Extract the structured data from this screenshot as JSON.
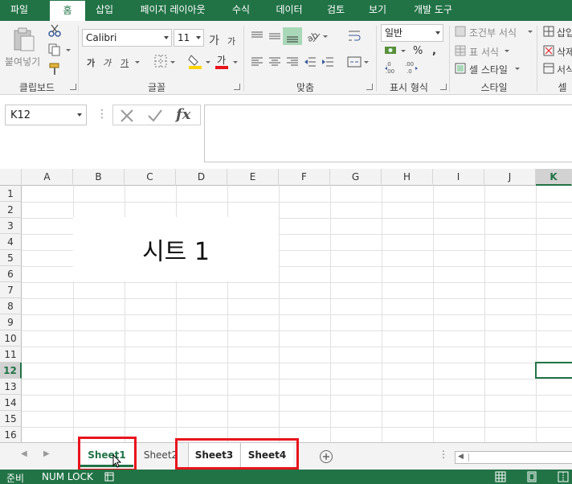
{
  "ribbon_tabs": [
    "파일",
    "홈",
    "삽입",
    "페이지 레이아웃",
    "수식",
    "데이터",
    "검토",
    "보기",
    "개발 도구"
  ],
  "active_tab": "홈",
  "clipboard": {
    "paste_label": "붙여넣기",
    "group_label": "클립보드"
  },
  "font": {
    "name": "Calibri",
    "size": "11",
    "bold": "가",
    "italic": "가",
    "underline": "가",
    "grow": "가",
    "shrink": "가",
    "font_color_char": "가",
    "group_label": "글꼴"
  },
  "alignment": {
    "group_label": "맞춤"
  },
  "number": {
    "format": "일반",
    "group_label": "표시 형식"
  },
  "styles": {
    "conditional": "조건부 서식",
    "table": "표 서식",
    "cell": "셀 스타일",
    "group_label": "스타일"
  },
  "cells": {
    "insert": "삽입",
    "delete": "삭제",
    "format": "서식",
    "group_label": "셀"
  },
  "name_box": "K12",
  "formula_value": "",
  "columns": [
    "A",
    "B",
    "C",
    "D",
    "E",
    "F",
    "G",
    "H",
    "I",
    "J",
    "K"
  ],
  "selected_column": "K",
  "rows": [
    "1",
    "2",
    "3",
    "4",
    "5",
    "6",
    "7",
    "8",
    "9",
    "10",
    "11",
    "12",
    "13",
    "14",
    "15",
    "16"
  ],
  "selected_row": "12",
  "textbox_text": "시트 1",
  "sheets": [
    "Sheet1",
    "Sheet2",
    "Sheet3",
    "Sheet4"
  ],
  "active_sheet": "Sheet1",
  "status": {
    "ready": "준비",
    "numlock": "NUM LOCK"
  },
  "colors": {
    "accent": "#217346",
    "highlight": "#e8141c"
  }
}
